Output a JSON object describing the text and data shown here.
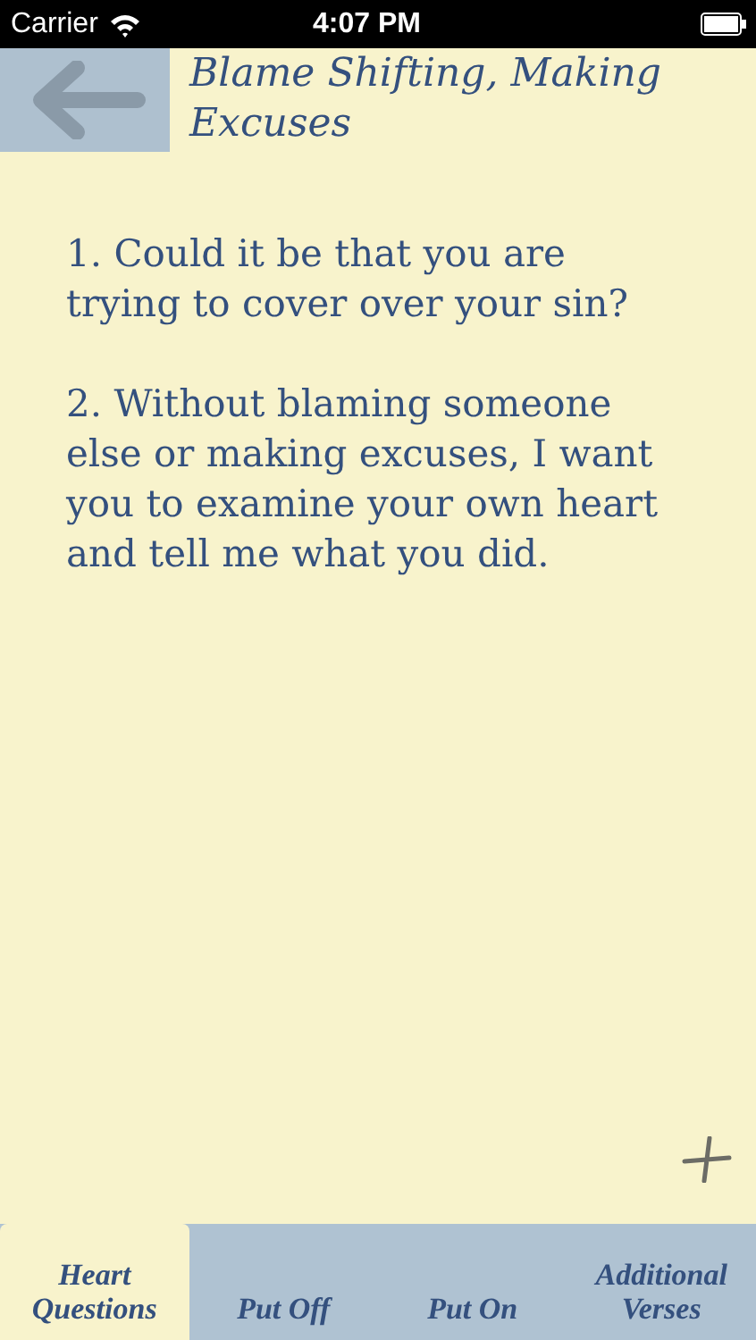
{
  "status_bar": {
    "carrier": "Carrier",
    "time": "4:07 PM"
  },
  "header": {
    "title": "Blame Shifting, Making Excuses"
  },
  "paragraphs": [
    "1. Could it be that you are trying to cover over your sin?",
    "2. Without blaming someone else or making excuses, I want you to examine your own heart and tell me what you did."
  ],
  "tabs": [
    {
      "label": "Heart Questions",
      "selected": true
    },
    {
      "label": "Put Off",
      "selected": false
    },
    {
      "label": "Put On",
      "selected": false
    },
    {
      "label": "Additional Verses",
      "selected": false
    }
  ]
}
